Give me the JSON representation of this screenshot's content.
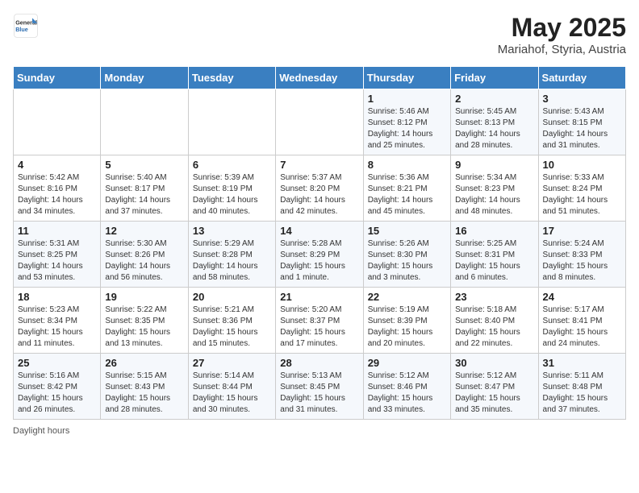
{
  "header": {
    "logo_general": "General",
    "logo_blue": "Blue",
    "title": "May 2025",
    "subtitle": "Mariahof, Styria, Austria"
  },
  "days_of_week": [
    "Sunday",
    "Monday",
    "Tuesday",
    "Wednesday",
    "Thursday",
    "Friday",
    "Saturday"
  ],
  "weeks": [
    [
      {
        "day": "",
        "info": ""
      },
      {
        "day": "",
        "info": ""
      },
      {
        "day": "",
        "info": ""
      },
      {
        "day": "",
        "info": ""
      },
      {
        "day": "1",
        "info": "Sunrise: 5:46 AM\nSunset: 8:12 PM\nDaylight: 14 hours\nand 25 minutes."
      },
      {
        "day": "2",
        "info": "Sunrise: 5:45 AM\nSunset: 8:13 PM\nDaylight: 14 hours\nand 28 minutes."
      },
      {
        "day": "3",
        "info": "Sunrise: 5:43 AM\nSunset: 8:15 PM\nDaylight: 14 hours\nand 31 minutes."
      }
    ],
    [
      {
        "day": "4",
        "info": "Sunrise: 5:42 AM\nSunset: 8:16 PM\nDaylight: 14 hours\nand 34 minutes."
      },
      {
        "day": "5",
        "info": "Sunrise: 5:40 AM\nSunset: 8:17 PM\nDaylight: 14 hours\nand 37 minutes."
      },
      {
        "day": "6",
        "info": "Sunrise: 5:39 AM\nSunset: 8:19 PM\nDaylight: 14 hours\nand 40 minutes."
      },
      {
        "day": "7",
        "info": "Sunrise: 5:37 AM\nSunset: 8:20 PM\nDaylight: 14 hours\nand 42 minutes."
      },
      {
        "day": "8",
        "info": "Sunrise: 5:36 AM\nSunset: 8:21 PM\nDaylight: 14 hours\nand 45 minutes."
      },
      {
        "day": "9",
        "info": "Sunrise: 5:34 AM\nSunset: 8:23 PM\nDaylight: 14 hours\nand 48 minutes."
      },
      {
        "day": "10",
        "info": "Sunrise: 5:33 AM\nSunset: 8:24 PM\nDaylight: 14 hours\nand 51 minutes."
      }
    ],
    [
      {
        "day": "11",
        "info": "Sunrise: 5:31 AM\nSunset: 8:25 PM\nDaylight: 14 hours\nand 53 minutes."
      },
      {
        "day": "12",
        "info": "Sunrise: 5:30 AM\nSunset: 8:26 PM\nDaylight: 14 hours\nand 56 minutes."
      },
      {
        "day": "13",
        "info": "Sunrise: 5:29 AM\nSunset: 8:28 PM\nDaylight: 14 hours\nand 58 minutes."
      },
      {
        "day": "14",
        "info": "Sunrise: 5:28 AM\nSunset: 8:29 PM\nDaylight: 15 hours\nand 1 minute."
      },
      {
        "day": "15",
        "info": "Sunrise: 5:26 AM\nSunset: 8:30 PM\nDaylight: 15 hours\nand 3 minutes."
      },
      {
        "day": "16",
        "info": "Sunrise: 5:25 AM\nSunset: 8:31 PM\nDaylight: 15 hours\nand 6 minutes."
      },
      {
        "day": "17",
        "info": "Sunrise: 5:24 AM\nSunset: 8:33 PM\nDaylight: 15 hours\nand 8 minutes."
      }
    ],
    [
      {
        "day": "18",
        "info": "Sunrise: 5:23 AM\nSunset: 8:34 PM\nDaylight: 15 hours\nand 11 minutes."
      },
      {
        "day": "19",
        "info": "Sunrise: 5:22 AM\nSunset: 8:35 PM\nDaylight: 15 hours\nand 13 minutes."
      },
      {
        "day": "20",
        "info": "Sunrise: 5:21 AM\nSunset: 8:36 PM\nDaylight: 15 hours\nand 15 minutes."
      },
      {
        "day": "21",
        "info": "Sunrise: 5:20 AM\nSunset: 8:37 PM\nDaylight: 15 hours\nand 17 minutes."
      },
      {
        "day": "22",
        "info": "Sunrise: 5:19 AM\nSunset: 8:39 PM\nDaylight: 15 hours\nand 20 minutes."
      },
      {
        "day": "23",
        "info": "Sunrise: 5:18 AM\nSunset: 8:40 PM\nDaylight: 15 hours\nand 22 minutes."
      },
      {
        "day": "24",
        "info": "Sunrise: 5:17 AM\nSunset: 8:41 PM\nDaylight: 15 hours\nand 24 minutes."
      }
    ],
    [
      {
        "day": "25",
        "info": "Sunrise: 5:16 AM\nSunset: 8:42 PM\nDaylight: 15 hours\nand 26 minutes."
      },
      {
        "day": "26",
        "info": "Sunrise: 5:15 AM\nSunset: 8:43 PM\nDaylight: 15 hours\nand 28 minutes."
      },
      {
        "day": "27",
        "info": "Sunrise: 5:14 AM\nSunset: 8:44 PM\nDaylight: 15 hours\nand 30 minutes."
      },
      {
        "day": "28",
        "info": "Sunrise: 5:13 AM\nSunset: 8:45 PM\nDaylight: 15 hours\nand 31 minutes."
      },
      {
        "day": "29",
        "info": "Sunrise: 5:12 AM\nSunset: 8:46 PM\nDaylight: 15 hours\nand 33 minutes."
      },
      {
        "day": "30",
        "info": "Sunrise: 5:12 AM\nSunset: 8:47 PM\nDaylight: 15 hours\nand 35 minutes."
      },
      {
        "day": "31",
        "info": "Sunrise: 5:11 AM\nSunset: 8:48 PM\nDaylight: 15 hours\nand 37 minutes."
      }
    ]
  ],
  "footer": {
    "daylight_label": "Daylight hours"
  }
}
